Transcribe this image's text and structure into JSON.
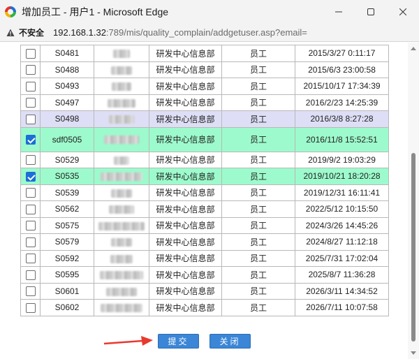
{
  "window": {
    "title": "增加员工 - 用户1 - Microsoft Edge"
  },
  "address": {
    "security_label": "不安全",
    "url_host": "192.168.1.32",
    "url_path": ":789/mis/quality_complain/addgetuser.asp?email="
  },
  "table": {
    "rows": [
      {
        "checked": false,
        "id": "S0481",
        "dept": "研发中心信息部",
        "role": "员工",
        "date": "2015/3/27 0:11:17",
        "state": ""
      },
      {
        "checked": false,
        "id": "S0488",
        "dept": "研发中心信息部",
        "role": "员工",
        "date": "2015/6/3 23:00:58",
        "state": ""
      },
      {
        "checked": false,
        "id": "S0493",
        "dept": "研发中心信息部",
        "role": "员工",
        "date": "2015/10/17 17:34:39",
        "state": ""
      },
      {
        "checked": false,
        "id": "S0497",
        "dept": "研发中心信息部",
        "role": "员工",
        "date": "2016/2/23 14:25:39",
        "state": ""
      },
      {
        "checked": false,
        "id": "S0498",
        "dept": "研发中心信息部",
        "role": "员工",
        "date": "2016/3/8 8:27:28",
        "state": "hover"
      },
      {
        "checked": true,
        "id": "sdf0505",
        "dept": "研发中心信息部",
        "role": "员工",
        "date": "2016/11/8 15:52:51",
        "state": "sel"
      },
      {
        "checked": false,
        "id": "S0529",
        "dept": "研发中心信息部",
        "role": "员工",
        "date": "2019/9/2 19:03:29",
        "state": ""
      },
      {
        "checked": true,
        "id": "S0535",
        "dept": "研发中心信息部",
        "role": "员工",
        "date": "2019/10/21 18:20:28",
        "state": "sel2"
      },
      {
        "checked": false,
        "id": "S0539",
        "dept": "研发中心信息部",
        "role": "员工",
        "date": "2019/12/31 16:11:41",
        "state": ""
      },
      {
        "checked": false,
        "id": "S0562",
        "dept": "研发中心信息部",
        "role": "员工",
        "date": "2022/5/12 10:15:50",
        "state": ""
      },
      {
        "checked": false,
        "id": "S0575",
        "dept": "研发中心信息部",
        "role": "员工",
        "date": "2024/3/26 14:45:26",
        "state": ""
      },
      {
        "checked": false,
        "id": "S0579",
        "dept": "研发中心信息部",
        "role": "员工",
        "date": "2024/8/27 11:12:18",
        "state": ""
      },
      {
        "checked": false,
        "id": "S0592",
        "dept": "研发中心信息部",
        "role": "员工",
        "date": "2025/7/31 17:02:04",
        "state": ""
      },
      {
        "checked": false,
        "id": "S0595",
        "dept": "研发中心信息部",
        "role": "员工",
        "date": "2025/8/7 11:36:28",
        "state": ""
      },
      {
        "checked": false,
        "id": "S0601",
        "dept": "研发中心信息部",
        "role": "员工",
        "date": "2026/3/11 14:34:52",
        "state": ""
      },
      {
        "checked": false,
        "id": "S0602",
        "dept": "研发中心信息部",
        "role": "员工",
        "date": "2026/7/11 10:07:58",
        "state": ""
      }
    ]
  },
  "actions": {
    "submit_label": "提交",
    "close_label": "关闭"
  },
  "colors": {
    "selected_row": "#9dfacc",
    "hover_row": "#dedff6",
    "button": "#3b86d6",
    "arrow": "#e8392f"
  }
}
